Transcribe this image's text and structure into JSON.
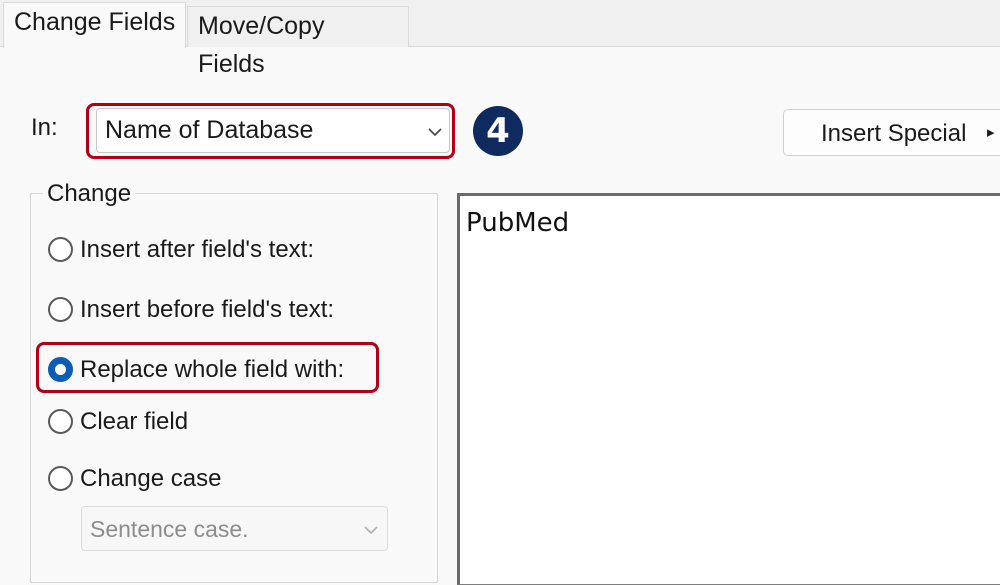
{
  "tabs": [
    {
      "label": "Change Fields",
      "active": true
    },
    {
      "label": "Move/Copy Fields",
      "active": false
    }
  ],
  "in_field": {
    "label": "In:",
    "selected": "Name of Database"
  },
  "step_badge": "4",
  "insert_special": {
    "label": "Insert Special",
    "arrow": "▸"
  },
  "change_group": {
    "title": "Change",
    "options": [
      {
        "label": "Insert after field's text:",
        "checked": false
      },
      {
        "label": "Insert before field's text:",
        "checked": false
      },
      {
        "label": "Replace whole field with:",
        "checked": true
      },
      {
        "label": "Clear field",
        "checked": false
      },
      {
        "label": "Change case",
        "checked": false
      }
    ],
    "case_select": {
      "selected": "Sentence case.",
      "disabled": true
    }
  },
  "replacement_text": "PubMed",
  "colors": {
    "highlight": "#b00016",
    "badge": "#0f2a5e",
    "radio_checked": "#0b5cb5"
  }
}
